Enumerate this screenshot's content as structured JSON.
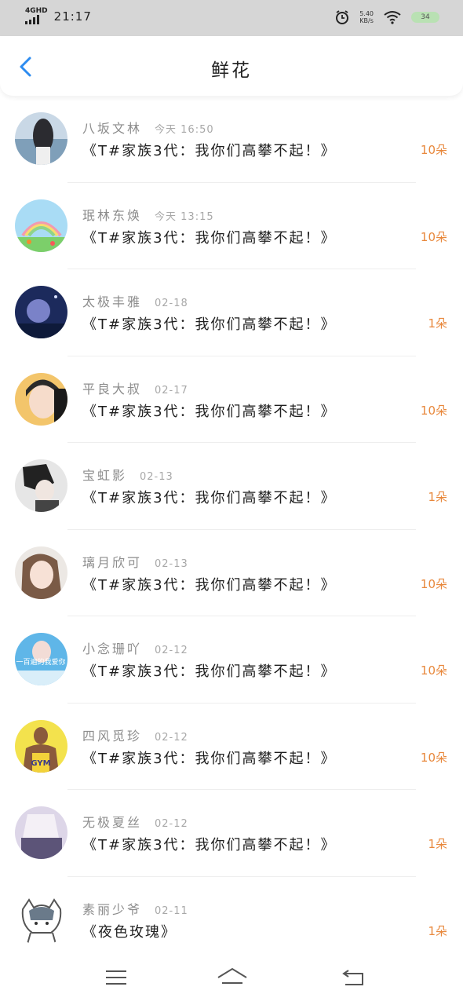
{
  "status_bar": {
    "network": "4GHD",
    "time": "21:17",
    "speed_value": "5.40",
    "speed_unit": "KB/s",
    "battery": "34"
  },
  "header": {
    "title": "鲜花",
    "back_icon": "chevron-left-icon"
  },
  "records": [
    {
      "name": "八坂文林",
      "time": "今天 16:50",
      "gift": "《T#家族3代：我你们高攀不起！》",
      "count": "10朵"
    },
    {
      "name": "珉林东焕",
      "time": "今天 13:15",
      "gift": "《T#家族3代：我你们高攀不起！》",
      "count": "10朵"
    },
    {
      "name": "太极丰雅",
      "time": "02-18",
      "gift": "《T#家族3代：我你们高攀不起！》",
      "count": "1朵"
    },
    {
      "name": "平良大叔",
      "time": "02-17",
      "gift": "《T#家族3代：我你们高攀不起！》",
      "count": "10朵"
    },
    {
      "name": "宝虹影",
      "time": "02-13",
      "gift": "《T#家族3代：我你们高攀不起！》",
      "count": "1朵"
    },
    {
      "name": "璃月欣可",
      "time": "02-13",
      "gift": "《T#家族3代：我你们高攀不起！》",
      "count": "10朵"
    },
    {
      "name": "小念珊吖",
      "time": "02-12",
      "gift": "《T#家族3代：我你们高攀不起！》",
      "count": "10朵"
    },
    {
      "name": "四风觅珍",
      "time": "02-12",
      "gift": "《T#家族3代：我你们高攀不起！》",
      "count": "10朵"
    },
    {
      "name": "无极夏丝",
      "time": "02-12",
      "gift": "《T#家族3代：我你们高攀不起！》",
      "count": "1朵"
    },
    {
      "name": "素丽少爷",
      "time": "02-11",
      "gift": "《夜色玫瑰》",
      "count": "1朵"
    }
  ],
  "avatar_text": {
    "row7": "一百遍的我爱你",
    "row8": "GYM"
  },
  "nav": {
    "menu_icon": "menu-icon",
    "home_icon": "home-icon",
    "back_icon": "return-icon"
  },
  "colors": {
    "accent_blue": "#2d8cf0",
    "count_orange": "#e8883c",
    "name_gray": "#8c8c8c",
    "status_bar_bg": "#d6d6d6"
  }
}
